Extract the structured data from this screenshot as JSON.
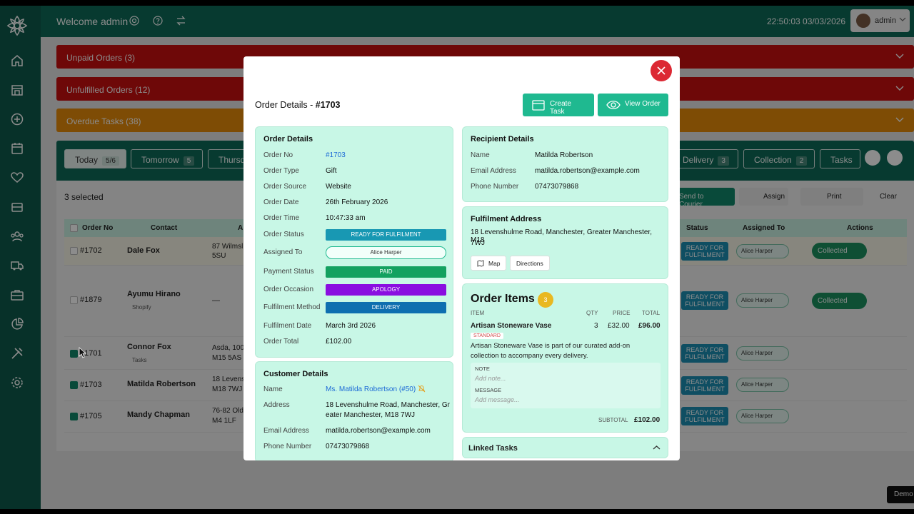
{
  "app": {
    "welcome": "Welcome admin",
    "clock": "22:50:03 03/03/2026",
    "user": "admin"
  },
  "alerts": [
    {
      "label": "Unpaid Orders (3)",
      "color": "#c9100f"
    },
    {
      "label": "Unfulfilled Orders (12)",
      "color": "#c9100f"
    },
    {
      "label": "Overdue Tasks (38)",
      "color": "#e58a0a"
    }
  ],
  "tabs": [
    {
      "label": "Today",
      "count": "5/6"
    },
    {
      "label": "Tomorrow",
      "count": "5"
    },
    {
      "label": "Thursd",
      "count": ""
    },
    {
      "label": "Delivery",
      "count": "3"
    },
    {
      "label": "Collection",
      "count": "2"
    },
    {
      "label": "Tasks",
      "count": ""
    }
  ],
  "toolbar": {
    "selected": "3 selected",
    "send": "Send to Courier",
    "assign": "Assign",
    "print": "Print",
    "clear": "Clear"
  },
  "table": {
    "headers": {
      "order": "Order No",
      "contact": "Contact",
      "address": "A",
      "status": "Status",
      "assigned": "Assigned To",
      "actions": "Actions"
    },
    "rows": [
      {
        "no": "#1702",
        "contact": "Dale Fox",
        "sub": "",
        "addr1": "87 Wilmsl",
        "addr2": "5SU",
        "status": "READY FOR FULFILMENT",
        "assigned": "Alice Harper",
        "action": "Collected"
      },
      {
        "no": "#1879",
        "contact": "Ayumu Hirano",
        "sub": "Shopify",
        "addr1": "—",
        "addr2": "",
        "status": "READY FOR FULFILMENT",
        "assigned": "Alice Harper",
        "action": "Collected"
      },
      {
        "no": "#1701",
        "contact": "Connor Fox",
        "sub": "Tasks",
        "addr1": "Asda, 100",
        "addr2": "M15 5AS",
        "status": "READY FOR FULFILMENT",
        "assigned": "Alice Harper",
        "action": ""
      },
      {
        "no": "#1703",
        "contact": "Matilda Robertson",
        "sub": "",
        "addr1": "18 Levens",
        "addr2": "M18 7WJ",
        "status": "READY FOR FULFILMENT",
        "assigned": "Alice Harper",
        "action": ""
      },
      {
        "no": "#1705",
        "contact": "Mandy Chapman",
        "sub": "",
        "addr1": "76-82 Old",
        "addr2": "M4 1LF",
        "status": "READY FOR FULFILMENT",
        "assigned": "Alice Harper",
        "action": ""
      }
    ]
  },
  "demo": "Demo",
  "modal": {
    "title": "Order Details - ",
    "title_no": "#1703",
    "create_task": "Create Task",
    "view_order": "View Order",
    "od": {
      "heading": "Order Details",
      "labels": [
        "Order No",
        "Order Type",
        "Order Source",
        "Order Date",
        "Order Time",
        "Order Status",
        "Assigned To",
        "Payment Status",
        "Order Occasion",
        "Fulfilment Method",
        "Fulfilment Date",
        "Order Total"
      ],
      "order_no": "#1703",
      "type": "Gift",
      "source": "Website",
      "date": "26th February 2026",
      "time": "10:47:33 am",
      "status": "READY FOR FULFILMENT",
      "assigned": "Alice Harper",
      "payment": "PAID",
      "occasion": "APOLOGY",
      "method": "DELIVERY",
      "fdate": "March 3rd 2026",
      "total": "£102.00"
    },
    "cust": {
      "heading": "Customer Details",
      "labels": [
        "Name",
        "Address",
        "Email Address",
        "Phone Number"
      ],
      "name": "Ms. Matilda Robertson (#50)",
      "address1": "18 Levenshulme Road, Manchester, Gr",
      "address2": "eater Manchester, M18 7WJ",
      "email": "matilda.robertson@example.com",
      "phone": "07473079868"
    },
    "recip": {
      "heading": "Recipient Details",
      "labels": [
        "Name",
        "Email Address",
        "Phone Number"
      ],
      "name": "Matilda Robertson",
      "email": "matilda.robertson@example.com",
      "phone": "07473079868"
    },
    "fulfil": {
      "heading": "Fulfilment Address",
      "line1": "18 Levenshulme Road, Manchester, Greater Manchester, M18",
      "line2": "7WJ",
      "map": "Map",
      "directions": "Directions"
    },
    "items": {
      "heading": "Order Items",
      "count": "3",
      "cols": [
        "ITEM",
        "QTY",
        "PRICE",
        "TOTAL"
      ],
      "name": "Artisan Stoneware Vase",
      "qty": "3",
      "price": "£32.00",
      "total": "£96.00",
      "tag": "STANDARD",
      "desc1": "Artisan Stoneware Vase is part of our curated add-on",
      "desc2": "collection to accompany every delivery.",
      "note_label": "NOTE",
      "note_ph": "Add note...",
      "msg_label": "MESSAGE",
      "msg_ph": "Add message...",
      "subtotal_label": "SUBTOTAL",
      "subtotal": "£102.00"
    },
    "linked": "Linked Tasks"
  },
  "colors": {
    "green": "#0e6b58",
    "teal": "#1fb990",
    "ready": "#1898b3",
    "paid": "#13a160",
    "occasion": "#8a0ee0",
    "delivery": "#0e6fb0"
  }
}
